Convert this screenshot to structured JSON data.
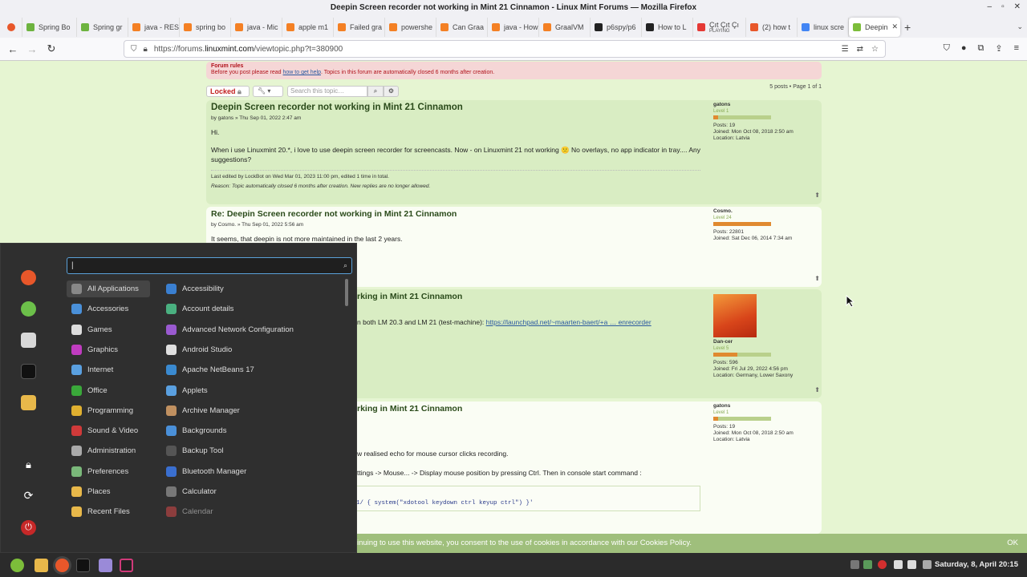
{
  "window": {
    "title": "Deepin Screen recorder not working in Mint 21 Cinnamon - Linux Mint Forums — Mozilla Firefox"
  },
  "tabs": [
    {
      "label": "Spring Bo",
      "color": "#6db33f"
    },
    {
      "label": "Spring gr",
      "color": "#6db33f"
    },
    {
      "label": "java - RES",
      "color": "#f48024"
    },
    {
      "label": "spring bo",
      "color": "#f48024"
    },
    {
      "label": "java - Mic",
      "color": "#f48024"
    },
    {
      "label": "apple m1",
      "color": "#f48024"
    },
    {
      "label": "Failed gra",
      "color": "#f48024"
    },
    {
      "label": "powershe",
      "color": "#f48024"
    },
    {
      "label": "Can Graa",
      "color": "#f48024"
    },
    {
      "label": "java - How",
      "color": "#f48024"
    },
    {
      "label": "GraalVM",
      "color": "#f48024"
    },
    {
      "label": "p6spy/p6",
      "color": "#222222"
    },
    {
      "label": "How to L",
      "color": "#222222"
    },
    {
      "label": "Çıt Çıt Çı",
      "sub": "PLAYING",
      "color": "#e53935"
    },
    {
      "label": "(2) how t",
      "color": "#e8572a"
    },
    {
      "label": "linux scre",
      "color": "#4285f4"
    },
    {
      "label": "Deepin",
      "color": "#7cbd3a",
      "active": true
    }
  ],
  "url": {
    "prefix": "https://forums.",
    "domain": "linuxmint.com",
    "path": "/viewtopic.php?t=380900"
  },
  "forum": {
    "rules_title": "Forum rules",
    "rules_text_before": "Before you post please read ",
    "rules_link": "how to get help",
    "rules_text_after": ". Topics in this forum are automatically closed 6 months after creation.",
    "locked_label": "Locked",
    "search_placeholder": "Search this topic…",
    "page_info": "5 posts • Page 1 of 1",
    "posts": [
      {
        "title": "Deepin Screen recorder not working in Mint 21 Cinnamon",
        "meta": "by gatons » Thu Sep 01, 2022 2:47 am",
        "text1": "Hi.",
        "text2": "When i use Linuxmint 20.*, i love to use deepin screen recorder for screencasts. Now - on Linuxmint 21 not working 😕 No overlays, no app indicator in tray.... Any suggestions?",
        "edit": "Last edited by LockBot on Wed Mar 01, 2023 11:00 pm, edited 1 time in total.",
        "reason": "Reason: Topic automatically closed 6 months after creation. New replies are no longer allowed.",
        "user": "gatons",
        "rank": "Level 1",
        "posts": "Posts: 19",
        "joined": "Joined: Mon Oct 08, 2018 2:50 am",
        "location": "Location: Latvia"
      },
      {
        "title": "Re: Deepin Screen recorder not working in Mint 21 Cinnamon",
        "meta": "by Cosmo. » Thu Sep 01, 2022 5:56 am",
        "text1": "It seems, that deepin is not more maintained in the last 2 years.",
        "user": "Cosmo.",
        "rank": "Level 24",
        "posts": "Posts: 22801",
        "joined": "Joined: Sat Dec 06, 2014 7:34 am"
      },
      {
        "title_visible": "rking in Mint 21 Cinnamon",
        "text_visible": "n both LM 20.3 and LM 21 (test-machine): ",
        "link": "https://launchpad.net/~maarten-baert/+a … enrecorder",
        "user": "Dan-cer",
        "rank": "Level 5",
        "posts": "Posts: 596",
        "joined": "Joined: Fri Jul 29, 2022 4:56 pm",
        "location": "Location: Germany, Lower Saxony"
      },
      {
        "title_visible": "rking in Mint 21 Cinnamon",
        "text_a": "w realised echo for mouse cursor clicks recording.",
        "text_b": "ttings -> Mouse... -> Display mouse position by pressing Ctrl. Then in console start command :",
        "code": "1/ { system(\"xdotool keydown ctrl keyup ctrl\") }'",
        "user": "gatons",
        "rank": "Level 1",
        "posts": "Posts: 19",
        "joined": "Joined: Mon Oct 08, 2018 2:50 am",
        "location": "Location: Latvia"
      }
    ],
    "cookie_text": "inuing to use this website, you consent to the use of cookies in accordance with our Cookies Policy.",
    "cookie_ok": "OK"
  },
  "menu": {
    "search_value": "|",
    "categories": [
      {
        "label": "All Applications",
        "color": "#888888"
      },
      {
        "label": "Accessories",
        "color": "#4a90d9"
      },
      {
        "label": "Games",
        "color": "#dddddd"
      },
      {
        "label": "Graphics",
        "color": "#c03cc0"
      },
      {
        "label": "Internet",
        "color": "#5aa0e0"
      },
      {
        "label": "Office",
        "color": "#3aa83a"
      },
      {
        "label": "Programming",
        "color": "#e0b030"
      },
      {
        "label": "Sound & Video",
        "color": "#d03a3a"
      },
      {
        "label": "Administration",
        "color": "#aaaaaa"
      },
      {
        "label": "Preferences",
        "color": "#7ab87a"
      },
      {
        "label": "Places",
        "color": "#e8b84a"
      },
      {
        "label": "Recent Files",
        "color": "#e8b84a"
      }
    ],
    "apps": [
      {
        "label": "Accessibility",
        "color": "#3a7fd0"
      },
      {
        "label": "Account details",
        "color": "#4ab080"
      },
      {
        "label": "Advanced Network Configuration",
        "color": "#9a5ad0"
      },
      {
        "label": "Android Studio",
        "color": "#e0e0e0"
      },
      {
        "label": "Apache NetBeans 17",
        "color": "#3a8ad0"
      },
      {
        "label": "Applets",
        "color": "#5aa0e0"
      },
      {
        "label": "Archive Manager",
        "color": "#c09060"
      },
      {
        "label": "Backgrounds",
        "color": "#4a90d9"
      },
      {
        "label": "Backup Tool",
        "color": "#555555"
      },
      {
        "label": "Bluetooth Manager",
        "color": "#3a6fd0"
      },
      {
        "label": "Calculator",
        "color": "#777777"
      },
      {
        "label": "Calendar",
        "color": "#d84a4a"
      }
    ]
  },
  "taskbar": {
    "clock": "Saturday, 8, April 20:15"
  }
}
